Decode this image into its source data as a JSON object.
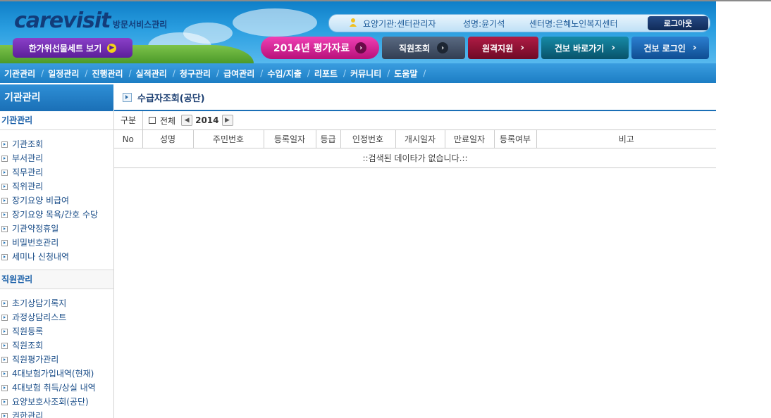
{
  "header": {
    "logo": "carevisit",
    "logo_subtitle": "방문서비스관리",
    "gift_button": "한가위선물세트 보기",
    "user_info": {
      "org": "요양기관:센터관리자",
      "name": "성명:윤기석",
      "center": "센터명:은혜노인복지센터"
    },
    "logout": "로그아웃",
    "eval_button": "2014년 평가자료",
    "buttons": {
      "staff_lookup": "직원조회",
      "remote_support": "원격지원",
      "gunbo_shortcut": "건보 바로가기",
      "gunbo_login": "건보 로그인"
    }
  },
  "nav": [
    "기관관리",
    "일정관리",
    "진행관리",
    "실적관리",
    "청구관리",
    "급여관리",
    "수입/지출",
    "리포트",
    "커뮤니티",
    "도움말"
  ],
  "sidebar": {
    "header": "기관관리",
    "sections": [
      {
        "title": "기관관리",
        "items": [
          "기관조회",
          "부서관리",
          "직무관리",
          "직위관리",
          "장기요양 비급여",
          "장기요양 목욕/간호 수당",
          "기관약정휴일",
          "비밀번호관리",
          "세미나 신청내역"
        ]
      },
      {
        "title": "직원관리",
        "items": [
          "초기상담기록지",
          "과정상담리스트",
          "직원등록",
          "직원조회",
          "직원평가관리",
          "4대보험가입내역(현재)",
          "4대보험 취득/상실 내역",
          "요양보호사조회(공단)",
          "권한관리"
        ]
      }
    ]
  },
  "main": {
    "title": "수급자조회(공단)",
    "filter": {
      "label": "구분",
      "all_label": "전체",
      "year": "2014"
    },
    "columns": [
      "No",
      "성명",
      "주민번호",
      "등록일자",
      "등급",
      "인정번호",
      "개시일자",
      "만료일자",
      "등록여부",
      "비고"
    ],
    "empty_message": "::검색된 데이타가 없습니다.::"
  },
  "colors": {
    "primary": "#1a6fb6",
    "eval": "#d21f92",
    "remote": "#8a1030",
    "teal": "#0d6e8a"
  }
}
